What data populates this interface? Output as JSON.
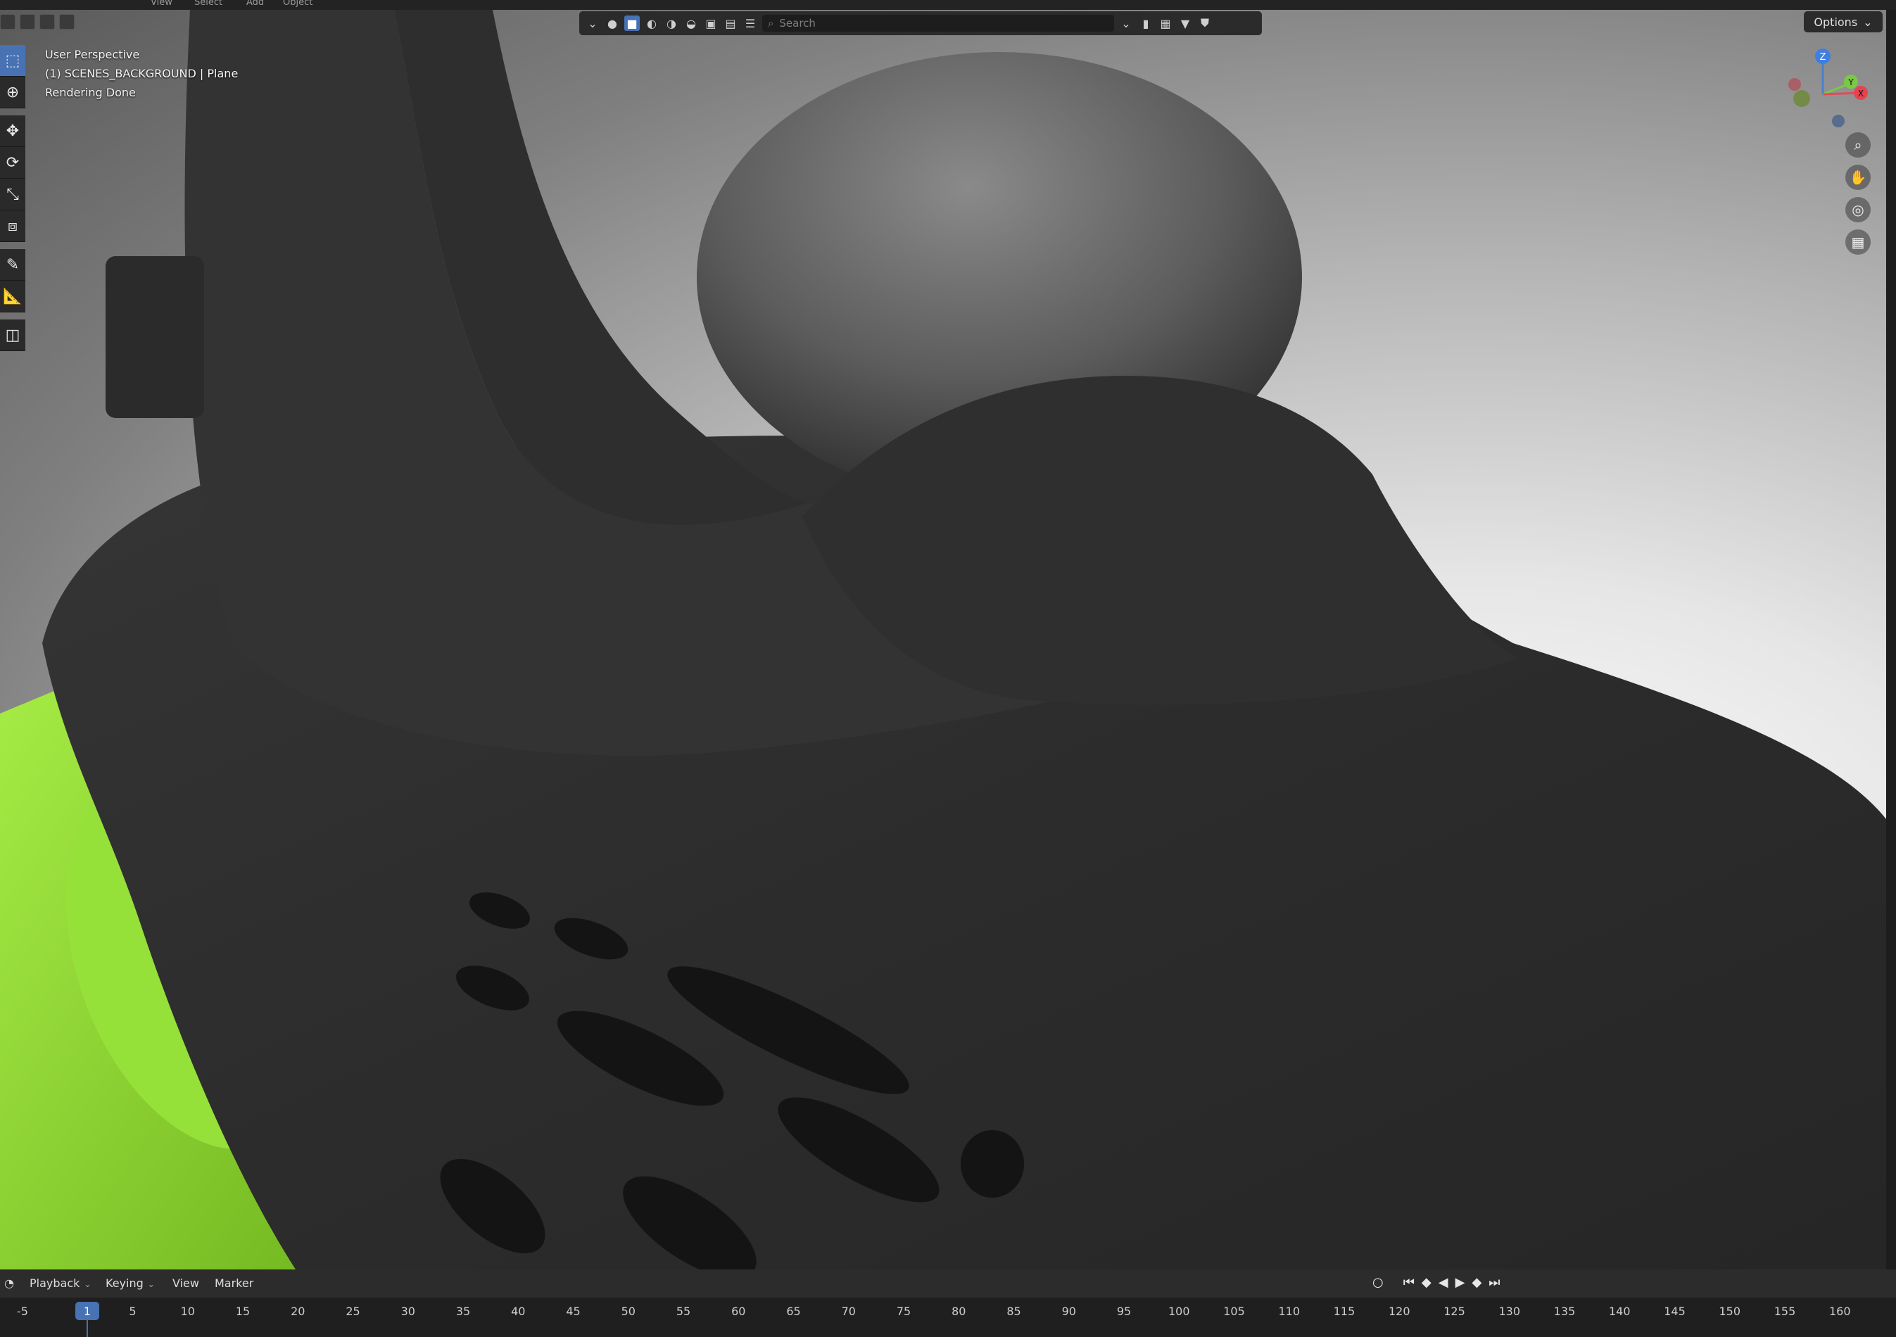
{
  "top_menu": [
    "View",
    "Select",
    "Add",
    "Object"
  ],
  "viewport": {
    "perspective": "User Perspective",
    "object": "(1) SCENES_BACKGROUND | Plane",
    "status": "Rendering Done",
    "search_placeholder": "Search",
    "options_label": "Options",
    "gizmo_axes": {
      "z": "Z",
      "y": "Y",
      "x": "X"
    }
  },
  "toolbar": {
    "tools": [
      "select-box",
      "cursor",
      "move",
      "rotate",
      "scale",
      "transform",
      "annotate",
      "measure",
      "add-cube"
    ],
    "active": "select-box"
  },
  "timeline": {
    "menus": [
      "Playback",
      "Keying",
      "View",
      "Marker"
    ],
    "current_frame": "1",
    "ticks": [
      "-5",
      "5",
      "10",
      "15",
      "20",
      "25",
      "30",
      "35",
      "40",
      "45",
      "50",
      "55",
      "60",
      "65",
      "70",
      "75",
      "80",
      "85",
      "90",
      "95",
      "100",
      "105",
      "110",
      "115",
      "120",
      "125",
      "130",
      "135",
      "140",
      "145",
      "150",
      "155",
      "160"
    ]
  },
  "colors": {
    "accent": "#4772b3",
    "shoe": "#2a2a2a",
    "sole": "#8fdc2a"
  }
}
